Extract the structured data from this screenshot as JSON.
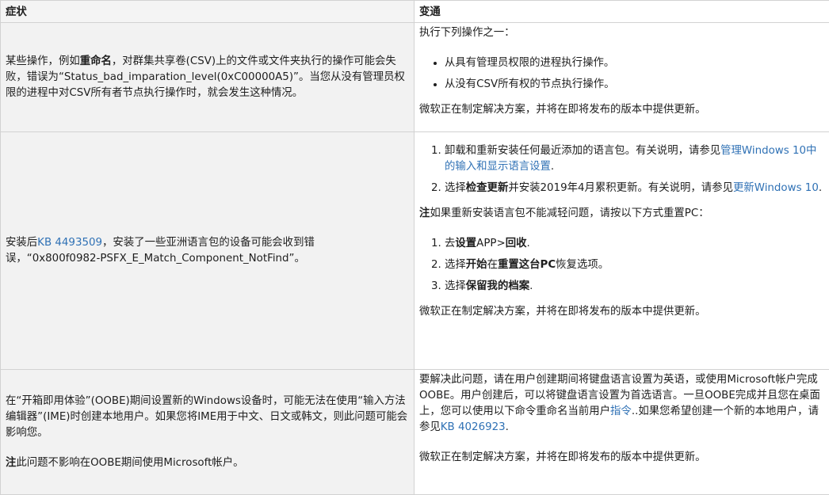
{
  "headers": {
    "symptom": "症状",
    "workaround": "变通"
  },
  "row1": {
    "symptom": {
      "pre": "某些操作，例如",
      "bold": "重命名",
      "post": "，对群集共享卷(CSV)上的文件或文件夹执行的操作可能会失败，错误为“Status_bad_imparation_level(0xC00000A5)”。当您从没有管理员权限的进程中对CSV所有者节点执行操作时，就会发生这种情况。"
    },
    "wk": {
      "intro": "执行下列操作之一：",
      "items": [
        "从具有管理员权限的进程执行操作。",
        "从没有CSV所有权的节点执行操作。"
      ],
      "footer": "微软正在制定解决方案，并将在即将发布的版本中提供更新。"
    }
  },
  "row2": {
    "symptom": {
      "pre": "安装后",
      "link": "KB 4493509",
      "post": "，安装了一些亚洲语言包的设备可能会收到错误，“0x800f0982-PSFX_E_Match_Component_NotFind”。"
    },
    "wk": {
      "step1_text": "卸载和重新安装任何最近添加的语言包。有关说明，请参见",
      "step1_link": "管理Windows 10中的输入和显示语言设置",
      "step1_end": ".",
      "step2_pre": "选择",
      "step2_bold": "检查更新",
      "step2_text": "并安装2019年4月累积更新。有关说明，请参见",
      "step2_link": "更新Windows 10",
      "step2_end": ".",
      "note_bold": "注",
      "note_text": "如果重新安装语言包不能减轻问题，请按以下方式重置PC：",
      "reset1_pre": "去",
      "reset1_b1": "设置",
      "reset1_mid": "APP>",
      "reset1_b2": "回收",
      "reset1_end": ".",
      "reset2_pre": "选择",
      "reset2_b1": "开始",
      "reset2_mid": "在",
      "reset2_b2": "重置这台PC",
      "reset2_end": "恢复选项。",
      "reset3_pre": "选择",
      "reset3_b": "保留我的档案",
      "reset3_end": ".",
      "footer": "微软正在制定解决方案，并将在即将发布的版本中提供更新。"
    }
  },
  "row3": {
    "symptom": {
      "text": "在“开箱即用体验”(OOBE)期间设置新的Windows设备时，可能无法在使用“输入方法编辑器”(IME)时创建本地用户。如果您将IME用于中文、日文或韩文，则此问题可能会影响您。",
      "note_bold": "注",
      "note_text": "此问题不影响在OOBE期间使用Microsoft帐户。"
    },
    "wk": {
      "text": "要解决此问题，请在用户创建期间将键盘语言设置为英语，或使用Microsoft帐户完成OOBE。用户创建后，可以将键盘语言设置为首选语言。一旦OOBE完成并且您在桌面上，您可以使用以下命令重命名当前用户",
      "link1": "指令",
      "mid": "..如果您希望创建一个新的本地用户，请参见",
      "link2": "KB 4026923",
      "end": ".",
      "footer": "微软正在制定解决方案，并将在即将发布的版本中提供更新。"
    }
  }
}
